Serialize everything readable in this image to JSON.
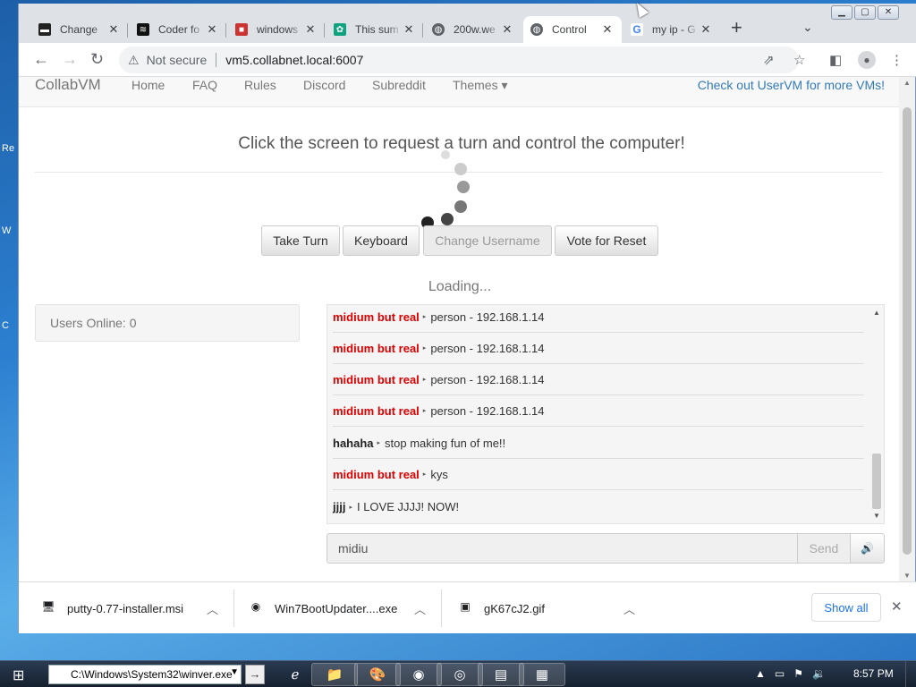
{
  "browser": {
    "tabs": [
      {
        "title": "Change",
        "favicon": "terminal-icon",
        "color": "#222"
      },
      {
        "title": "Coder fo",
        "favicon": "waveform-icon",
        "color": "#111"
      },
      {
        "title": "windows",
        "favicon": "bookmark-icon",
        "color": "#c33"
      },
      {
        "title": "This sum",
        "favicon": "chatgpt-icon",
        "color": "#10a37f"
      },
      {
        "title": "200w.we",
        "favicon": "globe-icon",
        "color": "#5f6368"
      },
      {
        "title": "Control",
        "favicon": "globe-icon",
        "color": "#5f6368"
      },
      {
        "title": "my ip - G",
        "favicon": "google-icon",
        "color": "#4285f4"
      }
    ],
    "active_tab": 5,
    "new_tab": "+",
    "address": {
      "security": "Not secure",
      "url": "vm5.collabnet.local:6007"
    }
  },
  "nav": {
    "brand": "CollabVM",
    "links": [
      "Home",
      "FAQ",
      "Rules",
      "Discord",
      "Subreddit",
      "Themes"
    ],
    "themes_caret": "▾",
    "promo": "Check out UserVM for more VMs!"
  },
  "main": {
    "prompt": "Click the screen to request a turn and control the computer!",
    "buttons": [
      "Take Turn",
      "Keyboard",
      "Change Username",
      "Vote for Reset"
    ],
    "loading": "Loading...",
    "users_online": "Users Online: 0"
  },
  "chat": {
    "messages": [
      {
        "user": "midium but real",
        "text": "person - 192.168.1.14",
        "color": "#d00"
      },
      {
        "user": "midium but real",
        "text": "person - 192.168.1.14",
        "color": "#d00"
      },
      {
        "user": "midium but real",
        "text": "person - 192.168.1.14",
        "color": "#d00"
      },
      {
        "user": "midium but real",
        "text": "person - 192.168.1.14",
        "color": "#d00"
      },
      {
        "user": "hahaha",
        "text": "stop making fun of me!!",
        "color": "#222"
      },
      {
        "user": "midium but real",
        "text": "kys",
        "color": "#d00"
      },
      {
        "user": "jjjj",
        "text": "I LOVE JJJJ! NOW!",
        "color": "#222"
      }
    ],
    "input_value": "midiu",
    "send_label": "Send",
    "volume_icon": "speaker-icon"
  },
  "downloads": {
    "items": [
      {
        "name": "putty-0.77-installer.msi",
        "icon": "msi-icon"
      },
      {
        "name": "Win7BootUpdater....exe",
        "icon": "exe-icon"
      },
      {
        "name": "gK67cJ2.gif",
        "icon": "image-icon"
      }
    ],
    "show_all": "Show all"
  },
  "taskbar": {
    "run_value": "C:\\Windows\\System32\\winver.exe",
    "run_arrow": "→",
    "time": "8:57 PM"
  }
}
